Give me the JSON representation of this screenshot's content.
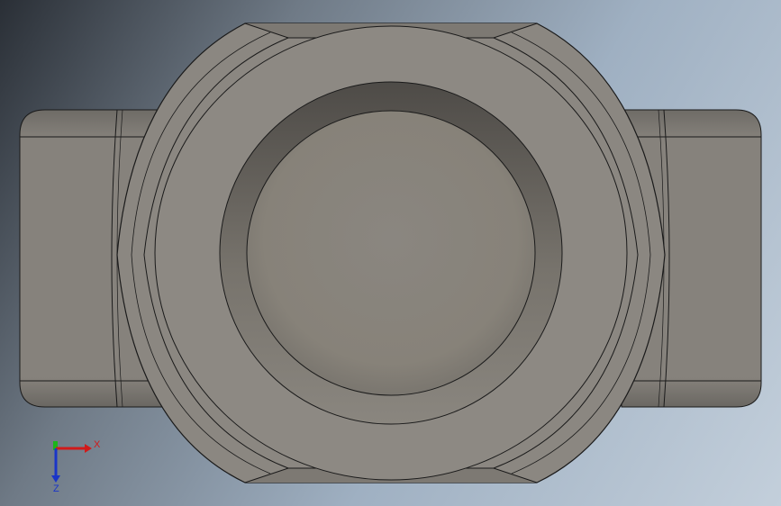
{
  "triad": {
    "x_label": "X",
    "z_label": "Z",
    "x_color": "#d11a1a",
    "y_color": "#1bb51b",
    "z_color": "#1a35c8"
  },
  "colors": {
    "part_face": "#8c8882",
    "part_shadow": "#6d6a65",
    "edge": "#1a1a1a"
  }
}
